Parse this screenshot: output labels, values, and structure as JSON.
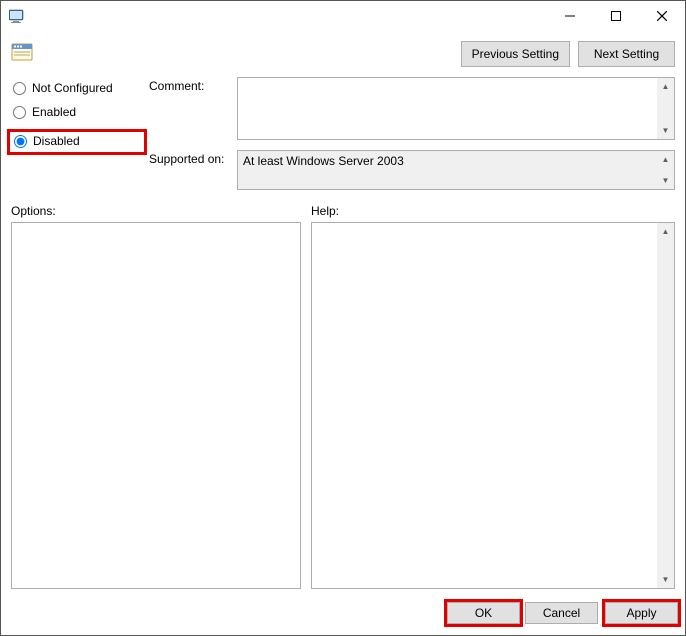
{
  "titlebar": {
    "title": ""
  },
  "nav": {
    "previous": "Previous Setting",
    "next": "Next Setting"
  },
  "radios": {
    "not_configured": "Not Configured",
    "enabled": "Enabled",
    "disabled": "Disabled",
    "selected": "disabled"
  },
  "fields": {
    "comment_label": "Comment:",
    "comment_value": "",
    "supported_label": "Supported on:",
    "supported_value": "At least Windows Server 2003"
  },
  "sections": {
    "options_label": "Options:",
    "help_label": "Help:",
    "options_text": "",
    "help_text": ""
  },
  "footer": {
    "ok": "OK",
    "cancel": "Cancel",
    "apply": "Apply"
  }
}
